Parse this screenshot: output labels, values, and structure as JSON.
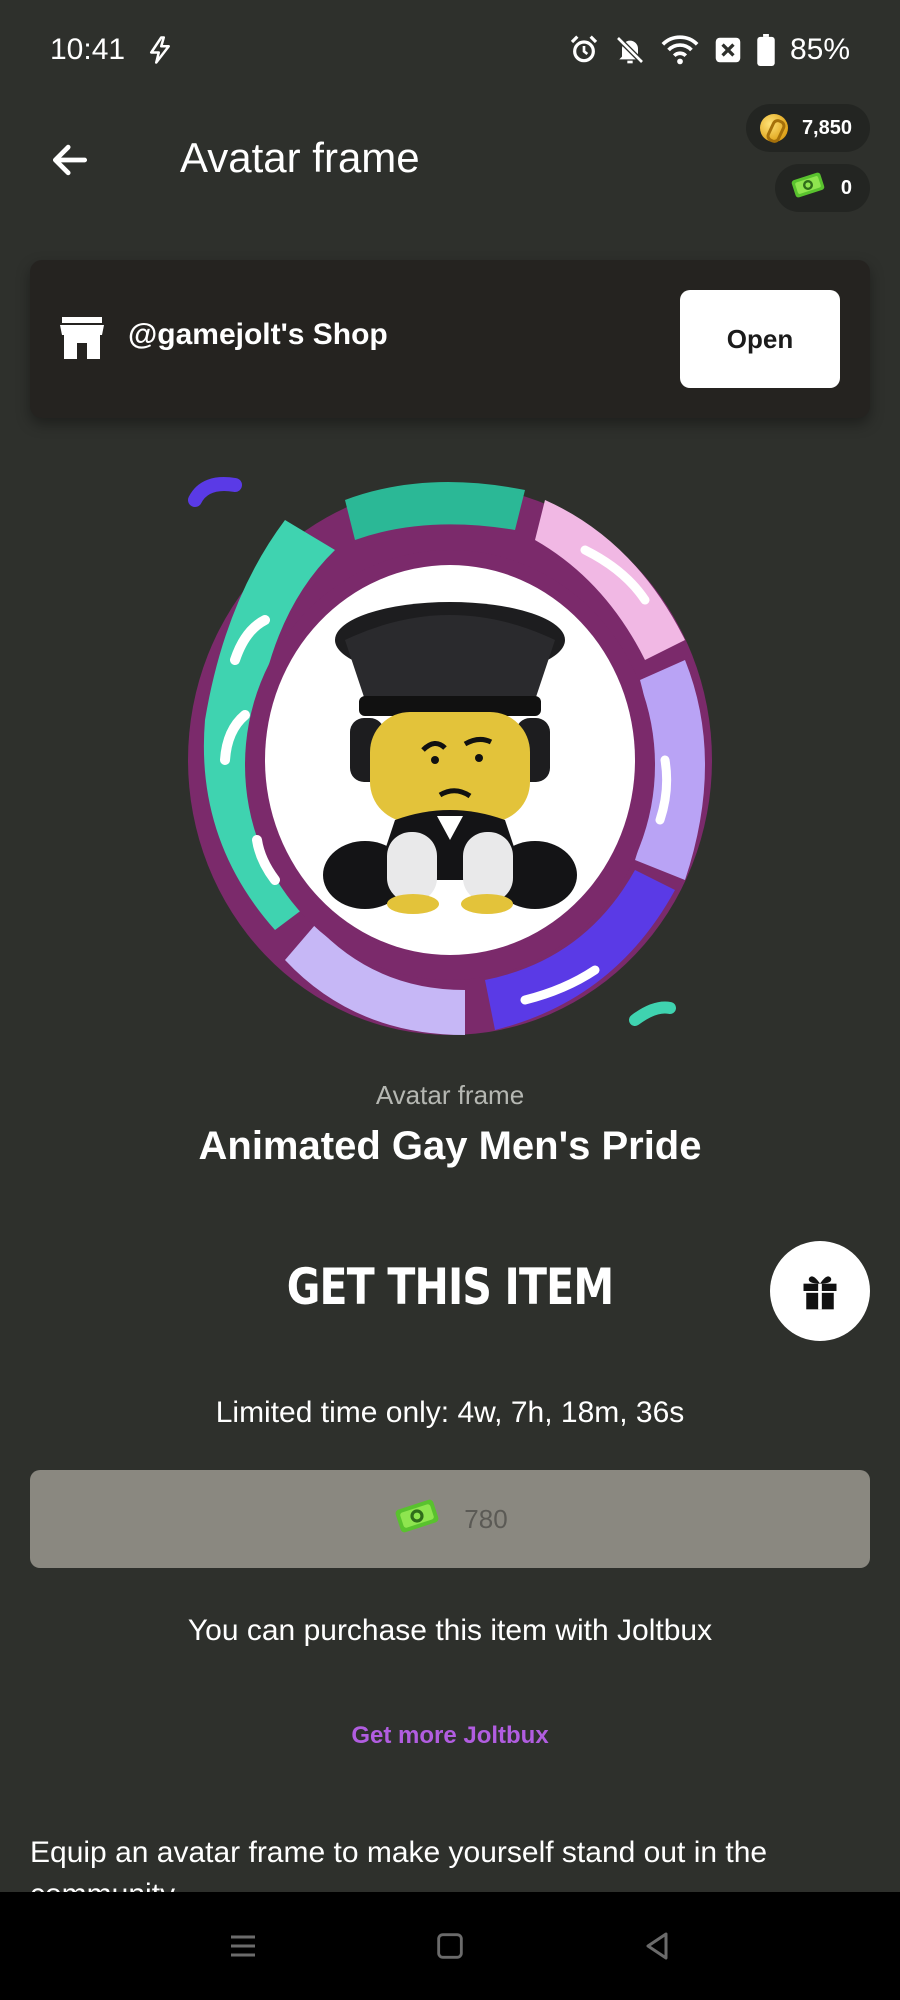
{
  "status_bar": {
    "time": "10:41",
    "battery": "85%",
    "icons": [
      "bolt-icon",
      "alarm-icon",
      "bell-off-icon",
      "wifi-icon",
      "close-box-icon",
      "battery-icon"
    ]
  },
  "header": {
    "title": "Avatar frame",
    "back_icon": "arrow-left-icon"
  },
  "wallet": {
    "coins": "7,850",
    "joltbux": "0"
  },
  "shop": {
    "label": "@gamejolt's Shop",
    "open_label": "Open",
    "icon": "storefront-icon"
  },
  "item": {
    "type": "Avatar frame",
    "name": "Animated Gay Men's Pride"
  },
  "purchase": {
    "title": "GET THIS ITEM",
    "limited_text": "Limited time only: 4w, 7h, 18m, 36s",
    "price": "780",
    "note": "You can purchase this item with Joltbux",
    "get_more_label": "Get more Joltbux",
    "gift_icon": "gift-icon"
  },
  "description": {
    "text": "Equip an avatar frame to make yourself stand out in the community."
  },
  "colors": {
    "background": "#2e302c",
    "card": "#252320",
    "link": "#b15de0",
    "price_button": "#8a8880"
  }
}
